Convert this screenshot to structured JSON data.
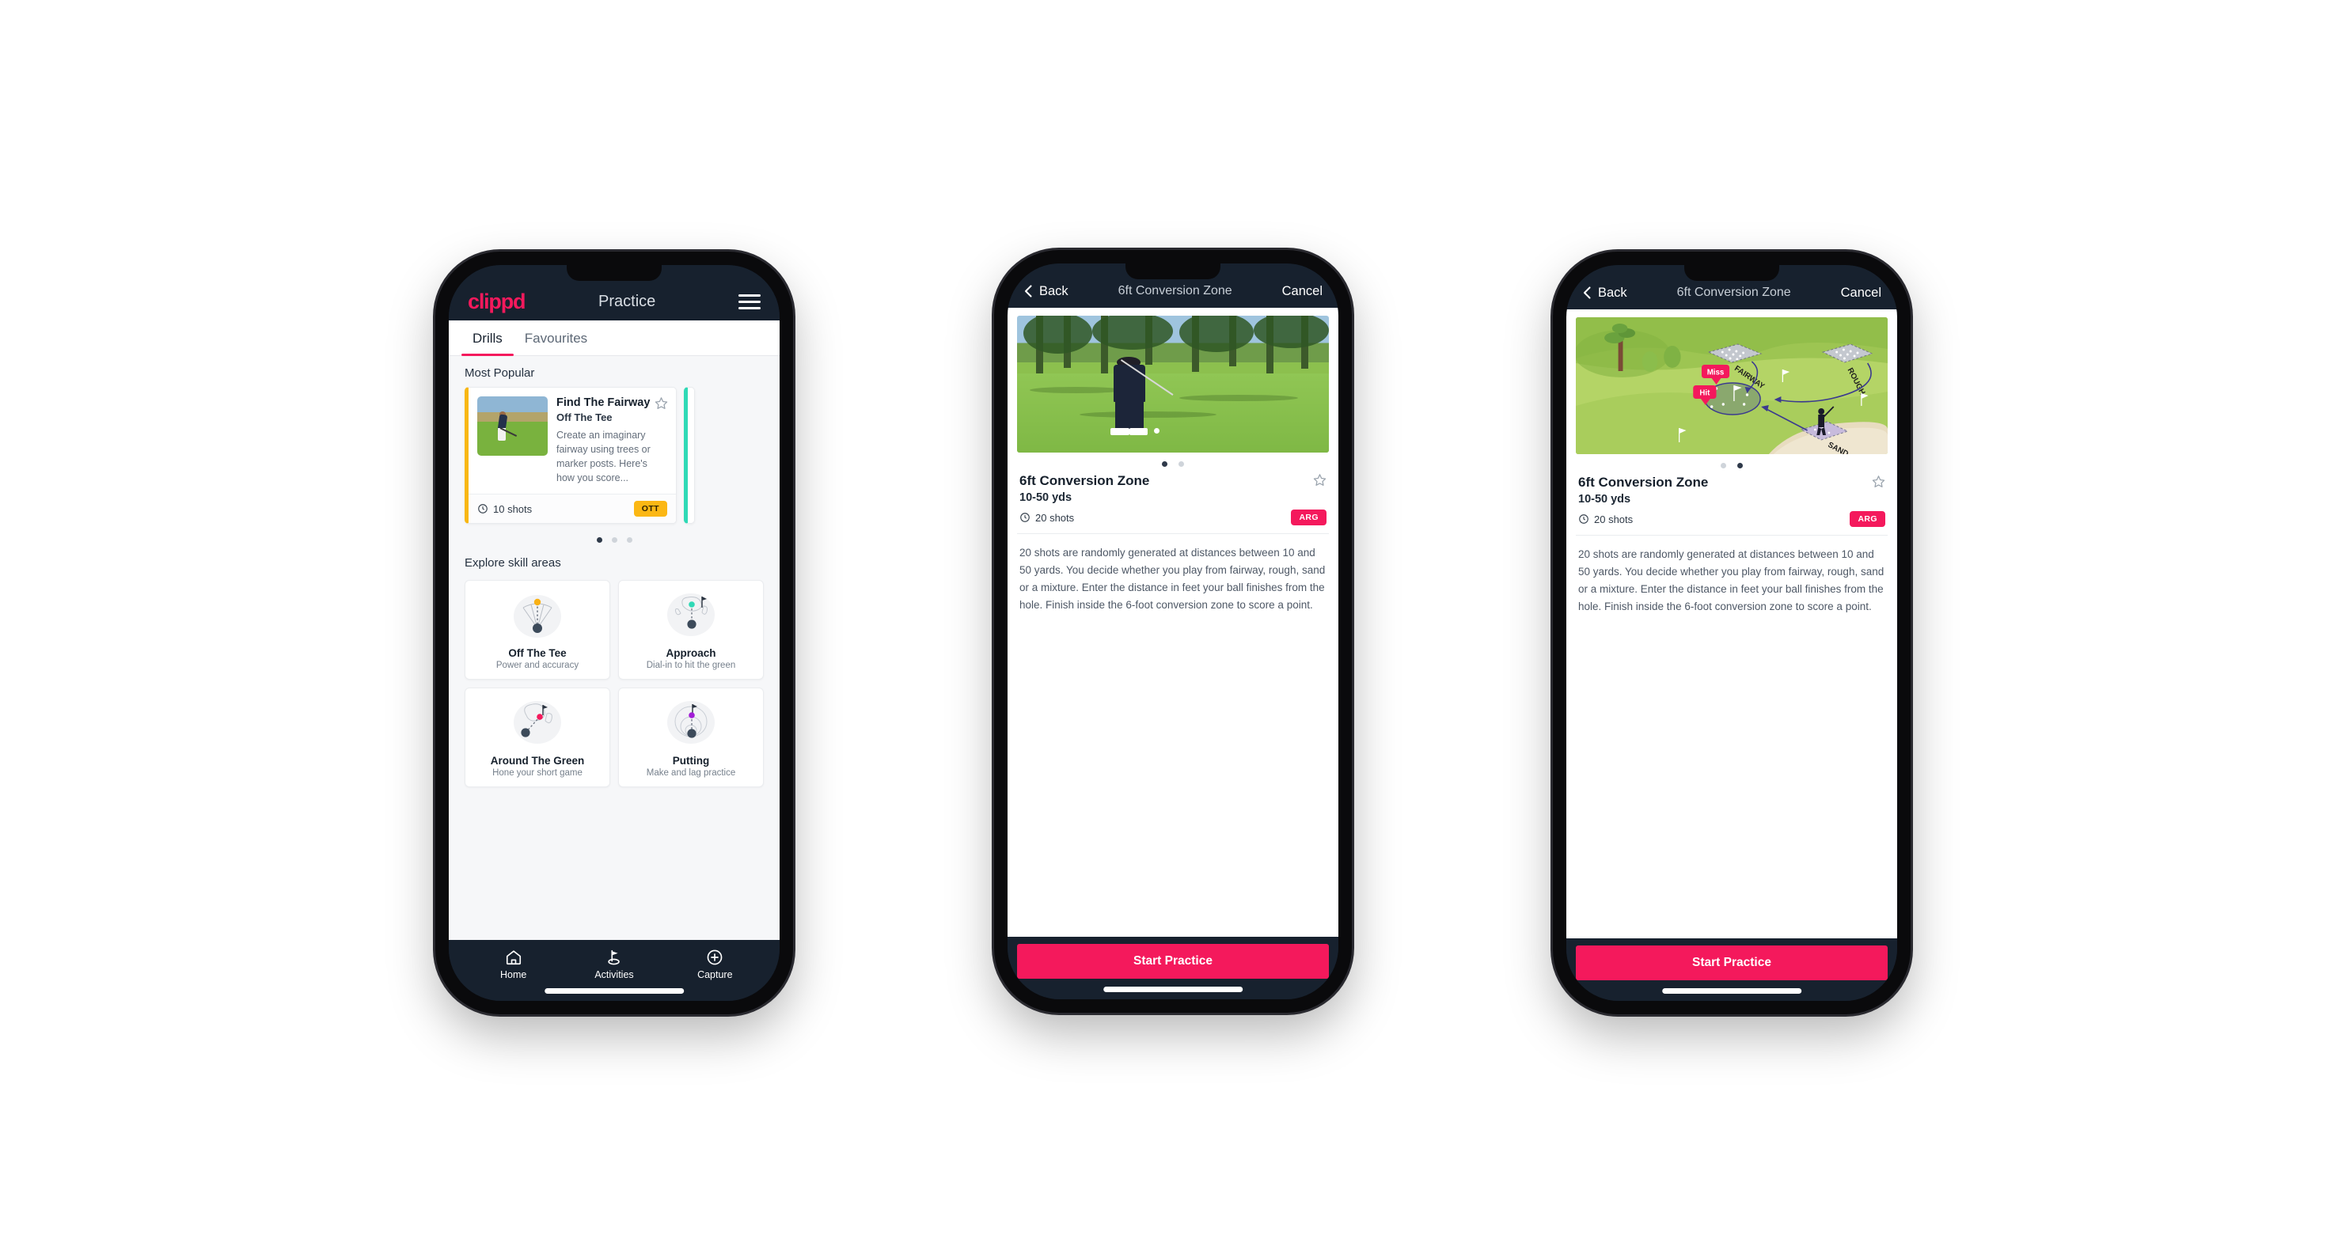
{
  "phone1": {
    "header": {
      "logo": "clippd",
      "title": "Practice",
      "menu_icon": "hamburger-icon"
    },
    "tabs": [
      {
        "label": "Drills",
        "active": true
      },
      {
        "label": "Favourites",
        "active": false
      }
    ],
    "sections": {
      "most_popular": "Most Popular",
      "explore": "Explore skill areas"
    },
    "drill_card": {
      "title": "Find The Fairway",
      "subtitle": "Off The Tee",
      "description": "Create an imaginary fairway using trees or marker posts. Here's how you score...",
      "shots": "10 shots",
      "badge": "OTT",
      "badge_color": "#fbb714",
      "accent_color": "#f8b712",
      "next_accent_color": "#2fd9b6",
      "star_icon": "star-outline-icon",
      "clock_icon": "clock-icon"
    },
    "carousel_dots": [
      true,
      false,
      false
    ],
    "skills": [
      {
        "name": "Off The Tee",
        "sub": "Power and accuracy",
        "icon": "tee-fan-icon",
        "dot_color": "#f9b115"
      },
      {
        "name": "Approach",
        "sub": "Dial-in to hit the green",
        "icon": "green-target-icon",
        "dot_color": "#2fd9b6"
      },
      {
        "name": "Around The Green",
        "sub": "Hone your short game",
        "icon": "chip-green-icon",
        "dot_color": "#f4195c"
      },
      {
        "name": "Putting",
        "sub": "Make and lag practice",
        "icon": "putt-rings-icon",
        "dot_color": "#a21cd6"
      }
    ],
    "bottom_nav": [
      {
        "label": "Home",
        "icon": "home-icon",
        "active": false
      },
      {
        "label": "Activities",
        "icon": "golf-flag-icon",
        "active": true
      },
      {
        "label": "Capture",
        "icon": "plus-circle-icon",
        "active": false
      }
    ]
  },
  "detail": {
    "nav": {
      "back": "Back",
      "title": "6ft Conversion Zone",
      "cancel": "Cancel",
      "back_icon": "chevron-left-icon"
    },
    "title": "6ft Conversion Zone",
    "yards": "10-50 yds",
    "shots": "20 shots",
    "badge": "ARG",
    "badge_color": "#f4195c",
    "star_icon": "star-outline-icon",
    "clock_icon": "clock-icon",
    "description": "20 shots are randomly generated at distances between 10 and 50 yards. You decide whether you play from fairway, rough, sand or a mixture. Enter the distance in feet your ball finishes from the hole. Finish inside the 6-foot conversion zone to score a point.",
    "cta": "Start Practice"
  },
  "phone2": {
    "hero_type": "photo",
    "dots": [
      true,
      false
    ]
  },
  "phone3": {
    "hero_type": "illustration",
    "dots": [
      false,
      true
    ],
    "illustration_labels": {
      "fairway": "FAIRWAY",
      "rough": "ROUGH",
      "sand": "SAND",
      "miss": "Miss",
      "hit": "Hit"
    }
  },
  "theme": {
    "brand_pink": "#f4195c",
    "navy": "#17212e",
    "page_bg": "#f6f7f9"
  }
}
